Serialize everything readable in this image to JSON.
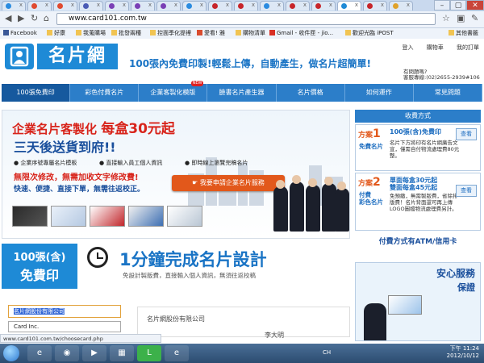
{
  "browser": {
    "url": "www.card101.com.tw",
    "window_buttons": [
      "–",
      "▢",
      "✕"
    ],
    "bookmarks": [
      "Facebook",
      "好康",
      "我蒐購場",
      "批發兩種",
      "控面季化提裡",
      "愛看! 雅",
      "購物清單",
      "Gmail - 收件匣 - jio...",
      "歡迎光臨 iPOST",
      "其他書籤"
    ],
    "status_url": "www.card101.com.tw/choosecard.php"
  },
  "header": {
    "logo_text": "名片網",
    "slogan": "100張內免費印製!輕鬆上傳，自動產生，做名片超簡單!",
    "top_links": [
      "登入",
      "購物車",
      "我的訂單"
    ],
    "contact_q": "有問題嗎?",
    "contact_phone": "客服專線:(02)2655-2939#106"
  },
  "nav": {
    "items": [
      "100張免費印",
      "彩色付費名片",
      "企業客製化模版",
      "臉書名片產生器",
      "名片價格",
      "如何運作",
      "常見問題"
    ],
    "new_badge": "NEW"
  },
  "banner": {
    "title": "企業名片客製化",
    "title_price": "每盒30元起",
    "subtitle": "三天後送貨到府!!",
    "features": [
      "企業序號專屬名片模板",
      "直接輸入員工個人資訊",
      "即時線上瀏覽完稿名片"
    ],
    "red_line": "無限次修改，無需加收文字修改費!",
    "blue_line": "快速、便捷、直接下單，無需往返校正。",
    "cta": "我要申請企業名片服務"
  },
  "payment": {
    "header": "收費方式",
    "plans": [
      {
        "prefix": "方案",
        "number": "1",
        "name_l1": "免費名片",
        "title": "100張(含)免費印",
        "desc": "名片下方將印有名片網廣告文宣，僅需自付物流處理費80元整。",
        "button": "查看"
      },
      {
        "prefix": "方案",
        "number": "2",
        "name_l1": "付費",
        "name_l2": "彩色名片",
        "title_l1": "單面每盒30元起",
        "title_l2": "雙面每盒45元起",
        "desc": "免預繳，無需製版費，省除排版費！名片背面還可再上傳LOGO圖檔物流處理費另計。",
        "button": "查看"
      }
    ],
    "atm": "付費方式有ATM/信用卡",
    "safe_title": "安心服務",
    "safe_sub": "保證"
  },
  "lower": {
    "free_l1": "100張(含)",
    "free_l2": "免費印",
    "design_title": "1分鐘完成名片設計",
    "design_sub": "免設計製版費，直接輸入個人資訊，無須往返校稿",
    "company_input": "名片網股份有限公司",
    "english_input": "Card Inc.",
    "card_company": "名片網股份有限公司",
    "card_name": "李大明"
  },
  "taskbar": {
    "lang": "CH",
    "time": "下午 11:24",
    "date": "2012/10/12"
  }
}
